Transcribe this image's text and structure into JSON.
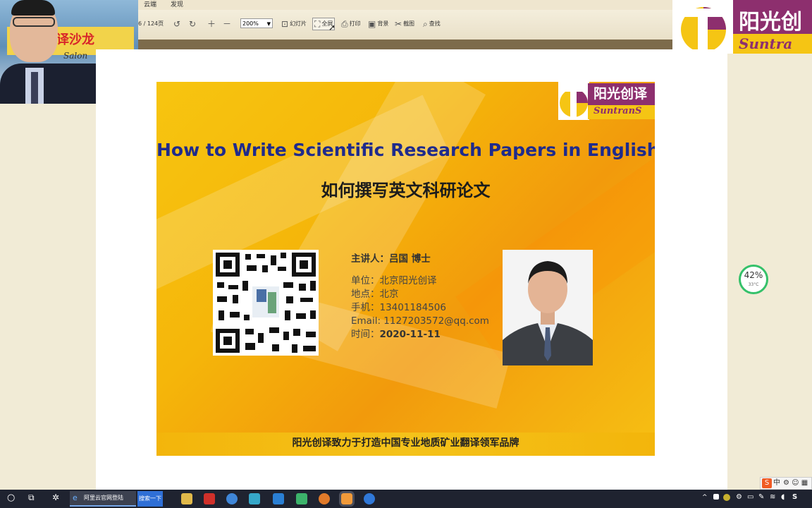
{
  "menu": {
    "tabs": [
      "云端",
      "发现"
    ]
  },
  "toolbar": {
    "page_indicator": "6 / 124页",
    "zoom_value": "200%",
    "slideshow_label": "幻灯片",
    "fullscreen_label": "全屏",
    "print_label": "打印",
    "background_label": "背景",
    "screenshot_label": "截图",
    "find_label": "查找"
  },
  "webcam": {
    "banner_text": "译沙龙",
    "salon_text": "Salon"
  },
  "brand": {
    "cn": "阳光创",
    "en": "Suntra"
  },
  "slide": {
    "logo_cn": "阳光创译",
    "logo_en": "SuntranS",
    "title_en": "How to Write Scientific Research Papers in English",
    "title_cn": "如何撰写英文科研论文",
    "presenter": "主讲人：吕国 博士",
    "info": [
      "单位：北京阳光创译",
      "地点：北京",
      "手机：13401184506",
      "Email: 1127203572@qq.com"
    ],
    "date_label": "时间：",
    "date_value": "2020-11-11",
    "footer": "阳光创译致力于打造中国专业地质矿业翻译领军品牌"
  },
  "widget": {
    "percent": "42%",
    "temp": "33°C"
  },
  "taskbar": {
    "ie_task_label": "阿里云官网登陆",
    "search_label": "搜索一下",
    "ime_label": "中"
  },
  "colors": {
    "accent_purple": "#8d2f6e",
    "accent_yellow": "#f5c514",
    "title_blue": "#1f2b8c"
  }
}
